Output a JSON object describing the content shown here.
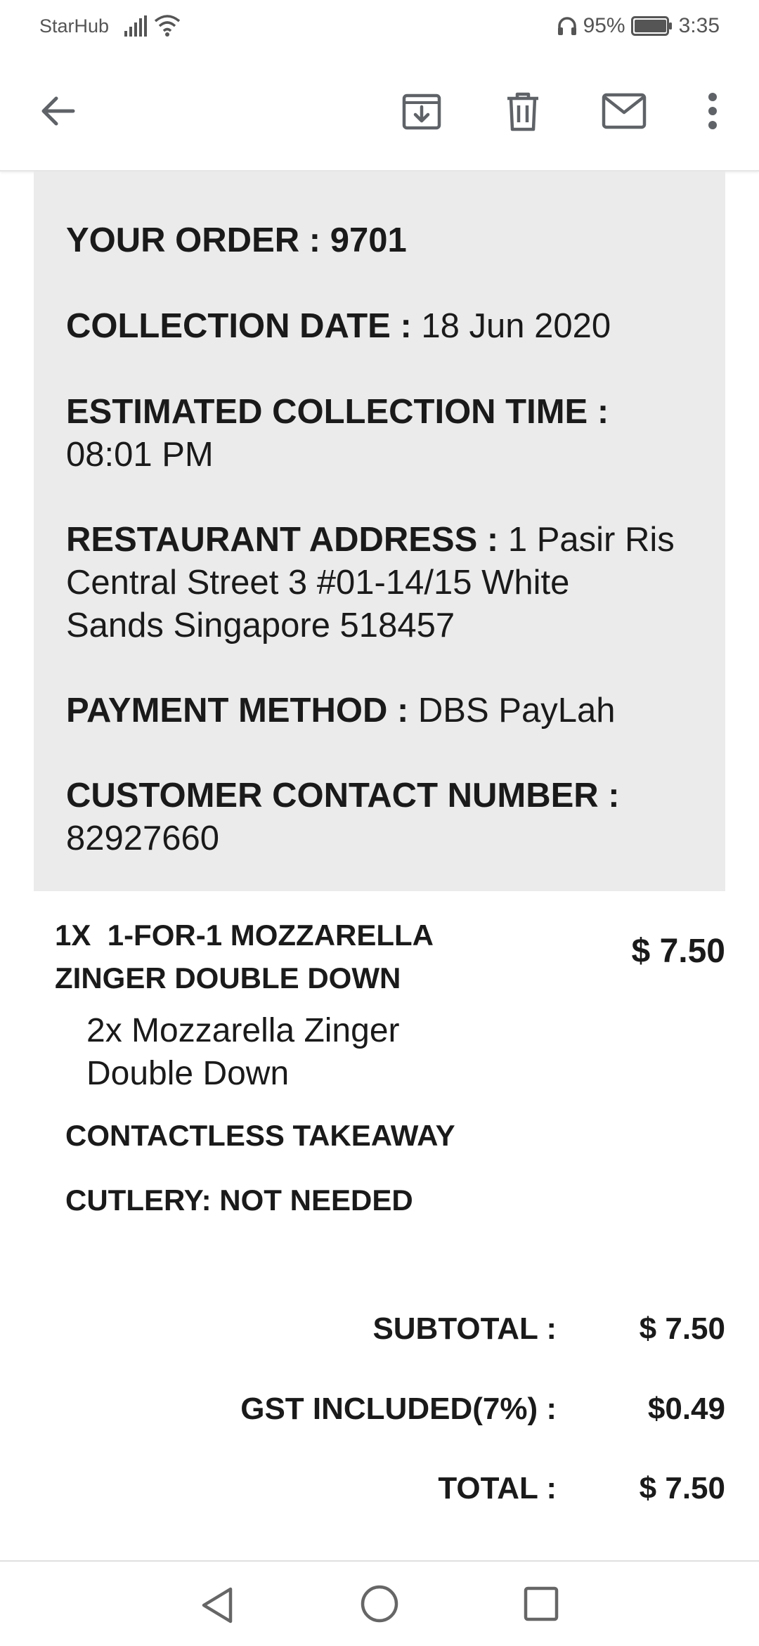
{
  "status_bar": {
    "carrier": "StarHub",
    "battery": "95%",
    "time": "3:35"
  },
  "toolbar": {
    "icons": [
      "back-arrow-icon",
      "archive-icon",
      "delete-icon",
      "mail-icon",
      "more-vert-icon"
    ]
  },
  "order": {
    "order_label": "YOUR ORDER :",
    "order_number": "9701",
    "collection_date_label": "COLLECTION DATE :",
    "collection_date": "18 Jun 2020",
    "collection_time_label": "ESTIMATED COLLECTION TIME :",
    "collection_time": "08:01 PM",
    "address_label": "RESTAURANT ADDRESS :",
    "address_line1": "1 Pasir Ris",
    "address_line2": "Central Street 3 #01-14/15 White",
    "address_line3": "Sands Singapore 518457",
    "payment_label": "PAYMENT METHOD :",
    "payment": "DBS PayLah",
    "contact_label": "CUSTOMER CONTACT NUMBER :",
    "contact": "82927660"
  },
  "item": {
    "name_line1": "1X  1-FOR-1 MOZZARELLA",
    "name_line2": "ZINGER DOUBLE DOWN",
    "price": "$ 7.50",
    "detail_line1": "2x Mozzarella Zinger",
    "detail_line2": "Double Down",
    "option1": "CONTACTLESS TAKEAWAY",
    "option2": "CUTLERY: NOT NEEDED"
  },
  "totals": {
    "subtotal_label": "SUBTOTAL :",
    "subtotal": "$ 7.50",
    "gst_label": "GST INCLUDED(7%) :",
    "gst": "$0.49",
    "total_label": "TOTAL :",
    "total": "$ 7.50"
  },
  "colors": {
    "card_bg": "#ebebeb",
    "icon": "#5f6368"
  }
}
